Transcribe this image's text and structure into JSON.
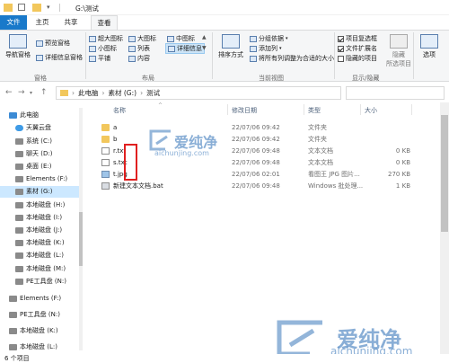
{
  "title_bar": {
    "path": "G:\\测试"
  },
  "tabs": [
    {
      "label": "文件"
    },
    {
      "label": "主页"
    },
    {
      "label": "共享"
    },
    {
      "label": "查看"
    }
  ],
  "ribbon": {
    "panes": {
      "nav_pane": "导航窗格",
      "preview": "预览窗格",
      "details": "详细信息窗格",
      "label": "窗格"
    },
    "layout": {
      "items": [
        "超大图标",
        "大图标",
        "中图标",
        "小图标",
        "列表",
        "详细信息",
        "平铺",
        "内容"
      ],
      "label": "布局"
    },
    "current_view": {
      "sort": "排序方式",
      "group_by": "分组依据",
      "add_column": "添加列",
      "fit_columns": "将所有列调整为合适的大小",
      "label": "当前视图"
    },
    "show_hide": {
      "item_checkbox": "项目复选框",
      "extensions": "文件扩展名",
      "hidden_items": "隐藏的项目",
      "hide_selected": "隐藏",
      "hide_selected_2": "所选项目",
      "label": "显示/隐藏"
    },
    "options": "选项"
  },
  "address": {
    "segments": [
      "此电脑",
      "素材 (G:)",
      "测试"
    ]
  },
  "nav_items": [
    {
      "label": "此电脑"
    },
    {
      "label": "天翼云盘"
    },
    {
      "label": "系统 (C:)"
    },
    {
      "label": "聊天 (D:)"
    },
    {
      "label": "桌面 (E:)"
    },
    {
      "label": "Elements (F:)"
    },
    {
      "label": "素材 (G:)"
    },
    {
      "label": "本地磁盘 (H:)"
    },
    {
      "label": "本地磁盘 (I:)"
    },
    {
      "label": "本地磁盘 (J:)"
    },
    {
      "label": "本地磁盘 (K:)"
    },
    {
      "label": "本地磁盘 (L:)"
    },
    {
      "label": "本地磁盘 (M:)"
    },
    {
      "label": "PE工具盘 (N:)"
    },
    {
      "label": "Elements (F:)"
    },
    {
      "label": "PE工具盘 (N:)"
    },
    {
      "label": "本地磁盘 (K:)"
    },
    {
      "label": "本地磁盘 (L:)"
    }
  ],
  "columns": {
    "name": "名称",
    "date": "修改日期",
    "type": "类型",
    "size": "大小"
  },
  "files": [
    {
      "name": "a",
      "date": "22/07/06 09:42",
      "type": "文件夹",
      "size": "",
      "kind": "folder"
    },
    {
      "name": "b",
      "date": "22/07/06 09:42",
      "type": "文件夹",
      "size": "",
      "kind": "folder"
    },
    {
      "name": "r.txt",
      "date": "22/07/06 09:48",
      "type": "文本文档",
      "size": "0 KB",
      "kind": "txt"
    },
    {
      "name": "s.txt",
      "date": "22/07/06 09:48",
      "type": "文本文档",
      "size": "0 KB",
      "kind": "txt"
    },
    {
      "name": "t.jpg",
      "date": "22/07/06 02:01",
      "type": "看图王 JPG 图片...",
      "size": "270 KB",
      "kind": "jpg"
    },
    {
      "name": "新建文本文档.bat",
      "date": "22/07/06 09:48",
      "type": "Windows 批处理...",
      "size": "1 KB",
      "kind": "bat"
    }
  ],
  "watermark": {
    "cn": "爱纯净",
    "url": "aichunjing.com"
  },
  "status": {
    "count": "6 个项目"
  }
}
